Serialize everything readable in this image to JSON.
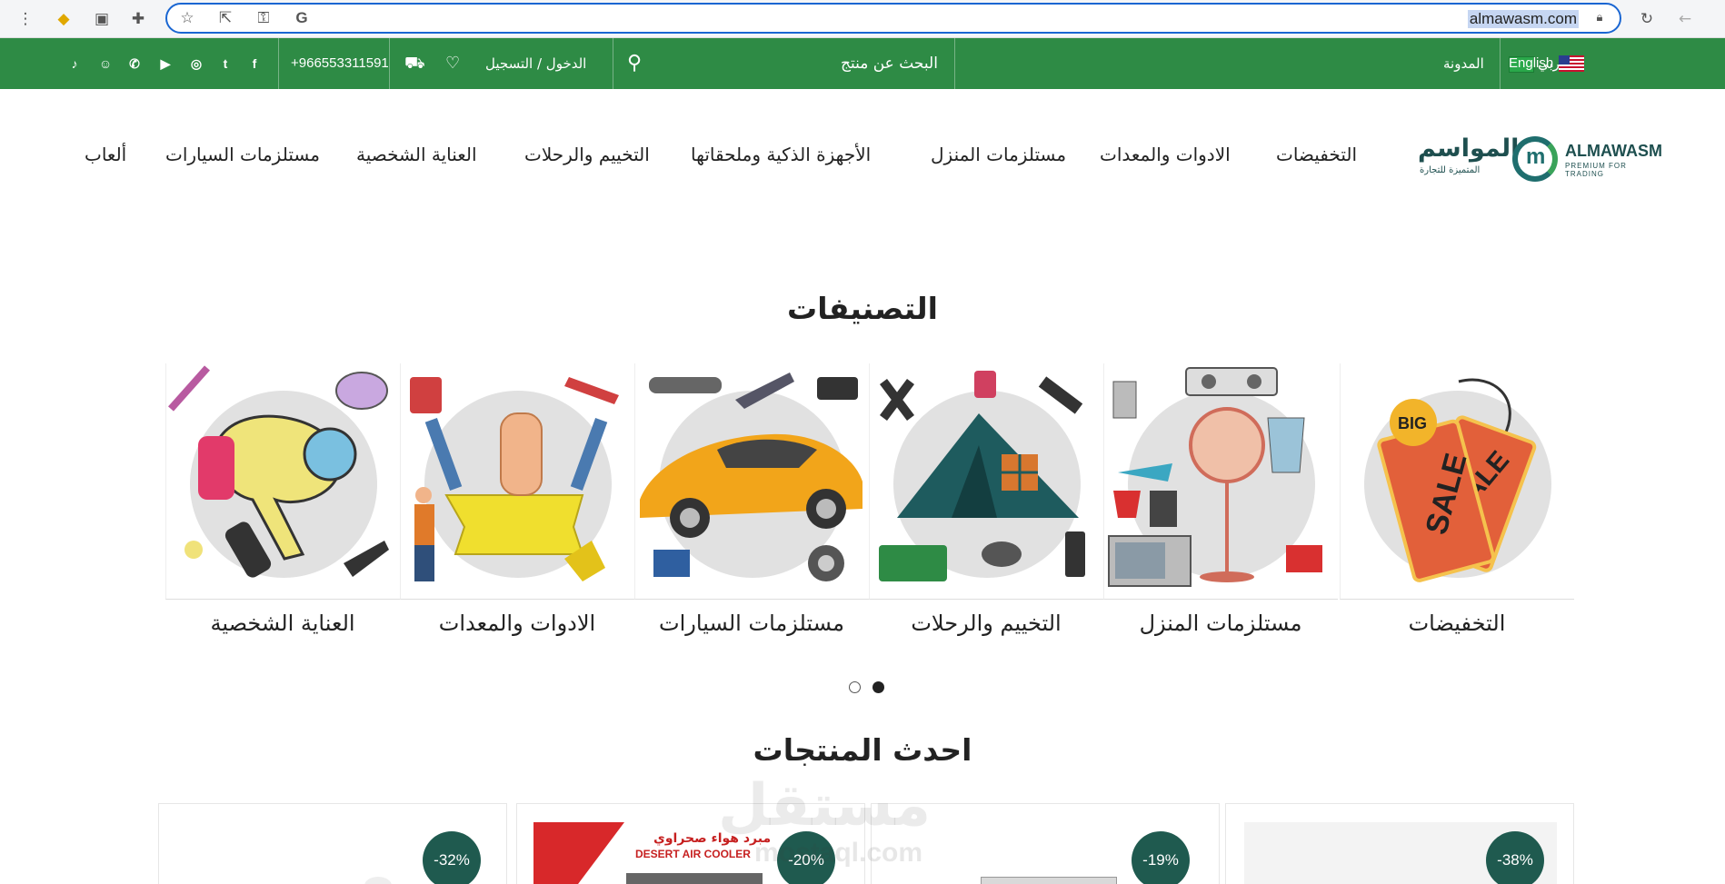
{
  "browser": {
    "url": "almawasm.com",
    "icons": [
      "menu-dots-icon",
      "extension-puzzle-icon",
      "sidebar-icon",
      "extensions-icon",
      "star-icon",
      "share-icon",
      "key-icon",
      "google-icon",
      "lock-icon",
      "reload-icon",
      "back-icon"
    ],
    "google_letter": "G"
  },
  "topbar": {
    "color": "#2e8b45",
    "lang_arabic": "عربي",
    "lang_english": "English",
    "blog": "المدونة",
    "search_placeholder": "البحث عن منتج",
    "login": "الدخول / التسجيل",
    "phone": "+966553311591",
    "social": [
      "facebook",
      "twitter",
      "instagram",
      "youtube",
      "whatsapp",
      "snapchat",
      "tiktok"
    ],
    "social_glyphs": [
      "f",
      "t",
      "◎",
      "▶",
      "✆",
      "☺",
      "♪"
    ]
  },
  "header": {
    "logo_ar": "المواسم",
    "logo_ar_sub": "المتميزة للتجارة",
    "logo_en": "ALMAWASM",
    "logo_en_sub": "PREMIUM FOR TRADING",
    "logo_mark": "m",
    "nav": [
      "التخفيضات",
      "الادوات والمعدات",
      "مستلزمات المنزل",
      "الأجهزة الذكية وملحقاتها",
      "التخييم والرحلات",
      "العناية الشخصية",
      "مستلزمات السيارات",
      "ألعاب"
    ]
  },
  "categories": {
    "title": "التصنيفات",
    "items": [
      {
        "label": "التخفيضات"
      },
      {
        "label": "مستلزمات المنزل"
      },
      {
        "label": "التخييم والرحلات"
      },
      {
        "label": "مستلزمات السيارات"
      },
      {
        "label": "الادوات والمعدات"
      },
      {
        "label": "العناية الشخصية"
      }
    ],
    "sale_tag_big": "BIG",
    "sale_tag_word": "SALE",
    "carousel_dots": 2,
    "active_dot": 2
  },
  "products": {
    "title": "احدث المنتجات",
    "badges": [
      "-38%",
      "-19%",
      "-20%",
      "-32%"
    ],
    "cooler_ar": "مبرد هواء صحراوي",
    "cooler_en": "DESERT AIR COOLER"
  },
  "watermark": {
    "ar": "مستقل",
    "en": "mostaql.com"
  }
}
